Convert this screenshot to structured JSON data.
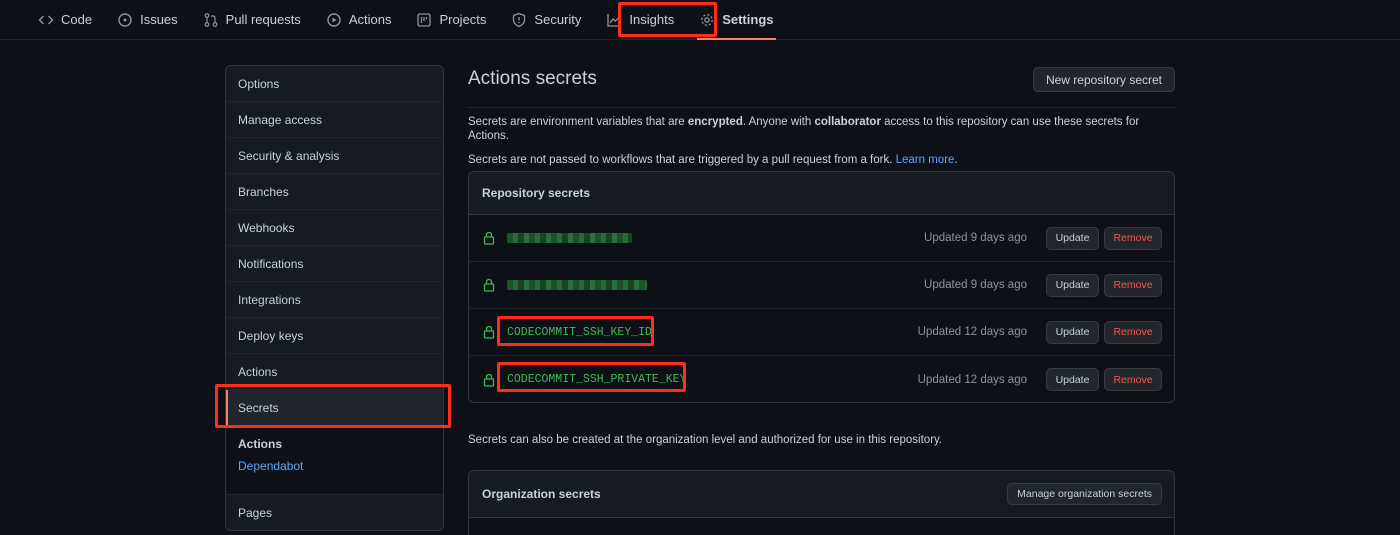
{
  "nav": {
    "tabs": [
      {
        "label": "Code",
        "icon": "code-icon"
      },
      {
        "label": "Issues",
        "icon": "issue-icon"
      },
      {
        "label": "Pull requests",
        "icon": "pull-request-icon"
      },
      {
        "label": "Actions",
        "icon": "play-icon"
      },
      {
        "label": "Projects",
        "icon": "project-icon"
      },
      {
        "label": "Security",
        "icon": "shield-icon"
      },
      {
        "label": "Insights",
        "icon": "graph-icon"
      },
      {
        "label": "Settings",
        "icon": "gear-icon"
      }
    ],
    "active": "Settings"
  },
  "sidebar": {
    "items": [
      "Options",
      "Manage access",
      "Security & analysis",
      "Branches",
      "Webhooks",
      "Notifications",
      "Integrations",
      "Deploy keys",
      "Actions",
      "Secrets"
    ],
    "selected": "Secrets",
    "subgroup": {
      "title": "Actions",
      "link": "Dependabot"
    },
    "last_item": "Pages"
  },
  "main": {
    "title": "Actions secrets",
    "new_button": "New repository secret",
    "desc1": {
      "p1": "Secrets are environment variables that are ",
      "b1": "encrypted",
      "p2": ". Anyone with ",
      "b2": "collaborator",
      "p3": " access to this repository can use these secrets for Actions."
    },
    "desc2": {
      "p1": "Secrets are not passed to workflows that are triggered by a pull request from a fork. ",
      "link": "Learn more",
      "p2": "."
    },
    "repo_secrets": {
      "title": "Repository secrets",
      "rows": [
        {
          "name": "",
          "updated": "Updated 9 days ago"
        },
        {
          "name": "",
          "updated": "Updated 9 days ago"
        },
        {
          "name": "CODECOMMIT_SSH_KEY_ID",
          "updated": "Updated 12 days ago"
        },
        {
          "name": "CODECOMMIT_SSH_PRIVATE_KEY",
          "updated": "Updated 12 days ago"
        }
      ],
      "update_label": "Update",
      "remove_label": "Remove"
    },
    "org_note": "Secrets can also be created at the organization level and authorized for use in this repository.",
    "org_secrets": {
      "title": "Organization secrets",
      "manage_button": "Manage organization secrets"
    }
  },
  "colors": {
    "background": "#0d1117",
    "accent_green": "#3fb950",
    "link_blue": "#58a6ff",
    "danger_red": "#f85149",
    "highlight_red": "#ff2d1a"
  }
}
